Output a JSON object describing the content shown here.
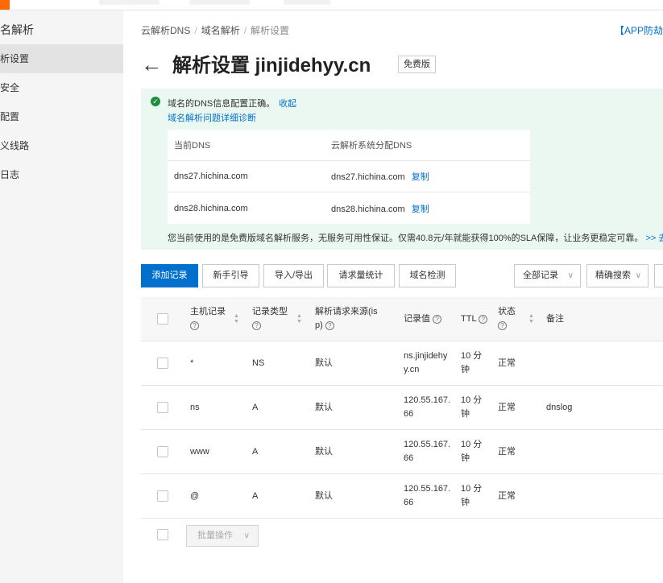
{
  "sidebar": {
    "title": "名解析",
    "items": [
      {
        "label": "析设置",
        "active": true
      },
      {
        "label": "安全",
        "active": false
      },
      {
        "label": "配置",
        "active": false
      },
      {
        "label": "义线路",
        "active": false
      },
      {
        "label": "日志",
        "active": false
      }
    ]
  },
  "breadcrumb": {
    "items": [
      "云解析DNS",
      "域名解析",
      "解析设置"
    ]
  },
  "app_link": "【APP防劫",
  "page": {
    "title": "解析设置 jinjidehyy.cn",
    "badge": "免费版"
  },
  "alert": {
    "message": "域名的DNS信息配置正确。",
    "collapse": "收起",
    "diagnose": "域名解析问题详细诊断",
    "table_headers": [
      "当前DNS",
      "云解析系统分配DNS"
    ],
    "rows": [
      {
        "current": "dns27.hichina.com",
        "assigned": "dns27.hichina.com",
        "copy": "复制"
      },
      {
        "current": "dns28.hichina.com",
        "assigned": "dns28.hichina.com",
        "copy": "复制"
      }
    ],
    "footer": "您当前使用的是免费版域名解析服务，无服务可用性保证。仅需40.8元/年就能获得100%的SLA保障，让业务更稳定可靠。",
    "footer_link": ">> 去升"
  },
  "toolbar": {
    "add": "添加记录",
    "guide": "新手引导",
    "import": "导入/导出",
    "stats": "请求量统计",
    "check": "域名检测",
    "filter": "全部记录",
    "search": "精确搜索"
  },
  "table": {
    "headers": {
      "host": "主机记录",
      "type": "记录类型",
      "line_a": "解析请求来源(is",
      "line_b": "p)",
      "value": "记录值",
      "ttl": "TTL",
      "status_a": "状态",
      "remark": "备注"
    },
    "rows": [
      {
        "host": "*",
        "type": "NS",
        "line": "默认",
        "value_a": "ns.jinjidehy",
        "value_b": "y.cn",
        "ttl_a": "10 分",
        "ttl_b": "钟",
        "status": "正常",
        "remark": ""
      },
      {
        "host": "ns",
        "type": "A",
        "line": "默认",
        "value_a": "120.55.167.",
        "value_b": "66",
        "ttl_a": "10 分",
        "ttl_b": "钟",
        "status": "正常",
        "remark": "dnslog"
      },
      {
        "host": "www",
        "type": "A",
        "line": "默认",
        "value_a": "120.55.167.",
        "value_b": "66",
        "ttl_a": "10 分",
        "ttl_b": "钟",
        "status": "正常",
        "remark": ""
      },
      {
        "host": "@",
        "type": "A",
        "line": "默认",
        "value_a": "120.55.167.",
        "value_b": "66",
        "ttl_a": "10 分",
        "ttl_b": "钟",
        "status": "正常",
        "remark": ""
      }
    ],
    "batch": "批量操作"
  }
}
